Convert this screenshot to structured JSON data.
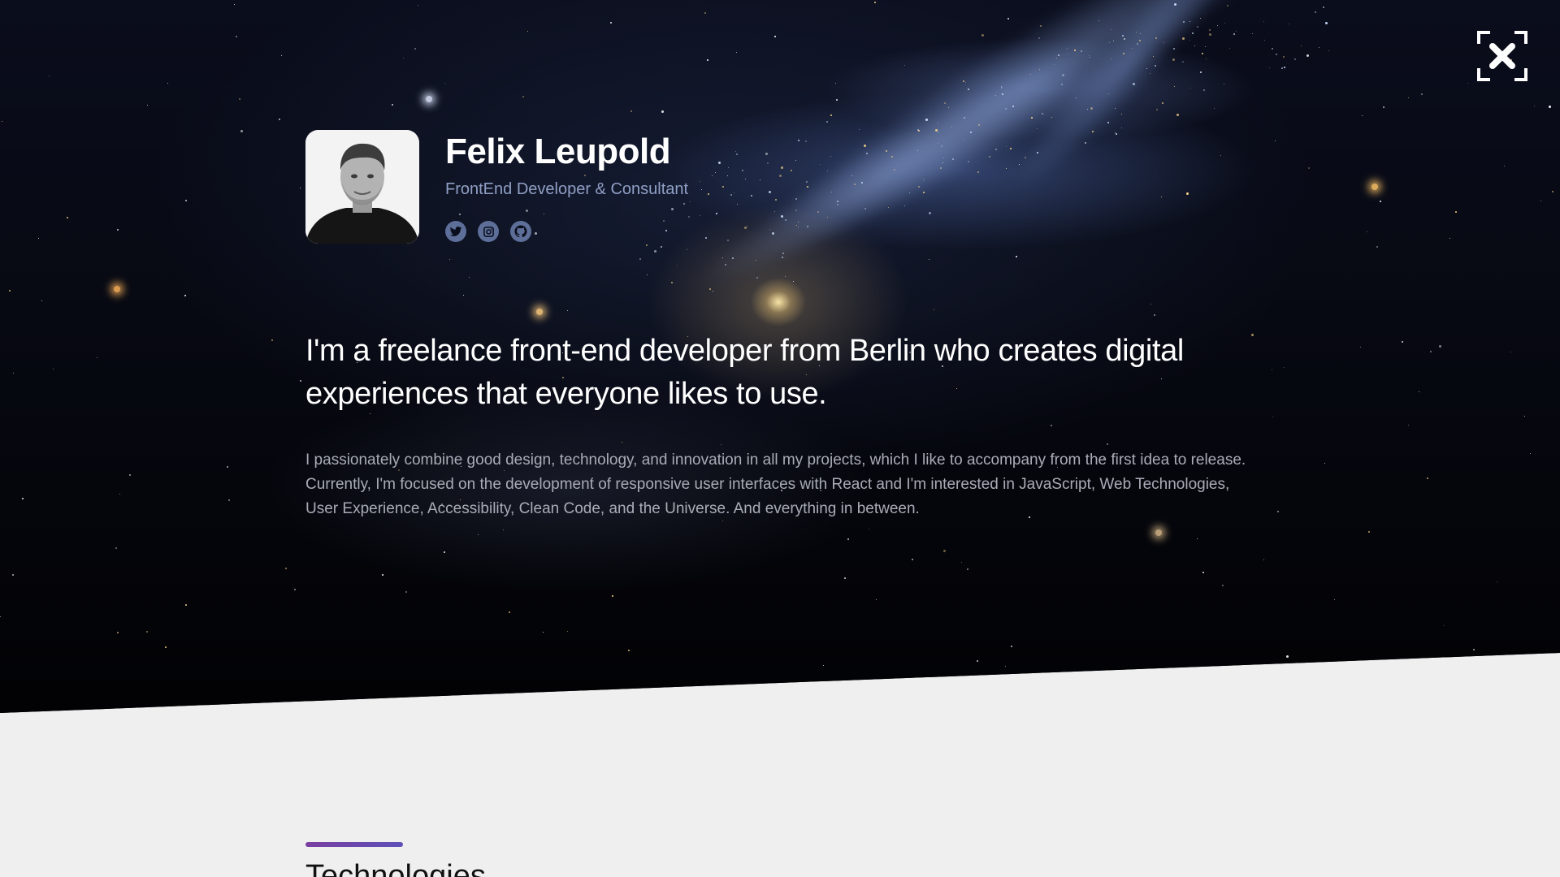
{
  "profile": {
    "name": "Felix Leupold",
    "role": "FrontEnd Developer & Consultant",
    "socials": [
      {
        "icon": "twitter-icon"
      },
      {
        "icon": "instagram-icon"
      },
      {
        "icon": "github-icon"
      }
    ]
  },
  "intro": {
    "lead": "I'm a freelance front-end developer from Berlin who creates digital experiences that everyone likes to use.",
    "bio": "I passionately combine good design, technology, and innovation in all my projects, which I like to accompany from the first idea to release. Currently, I'm focused on the development of responsive user interfaces with React and I'm interested in JavaScript, Web Technologies, User Experience, Accessibility, Clean Code, and the Universe. And everything in between."
  },
  "next_section": {
    "title": "Technologies"
  },
  "colors": {
    "hero_background": "#05060b",
    "page_background": "#efefef",
    "role_text": "#8f9fc4",
    "social_icon": "#5d6f99",
    "accent_bar_start": "#7a3fa0",
    "accent_bar_end": "#5d4fb8"
  }
}
